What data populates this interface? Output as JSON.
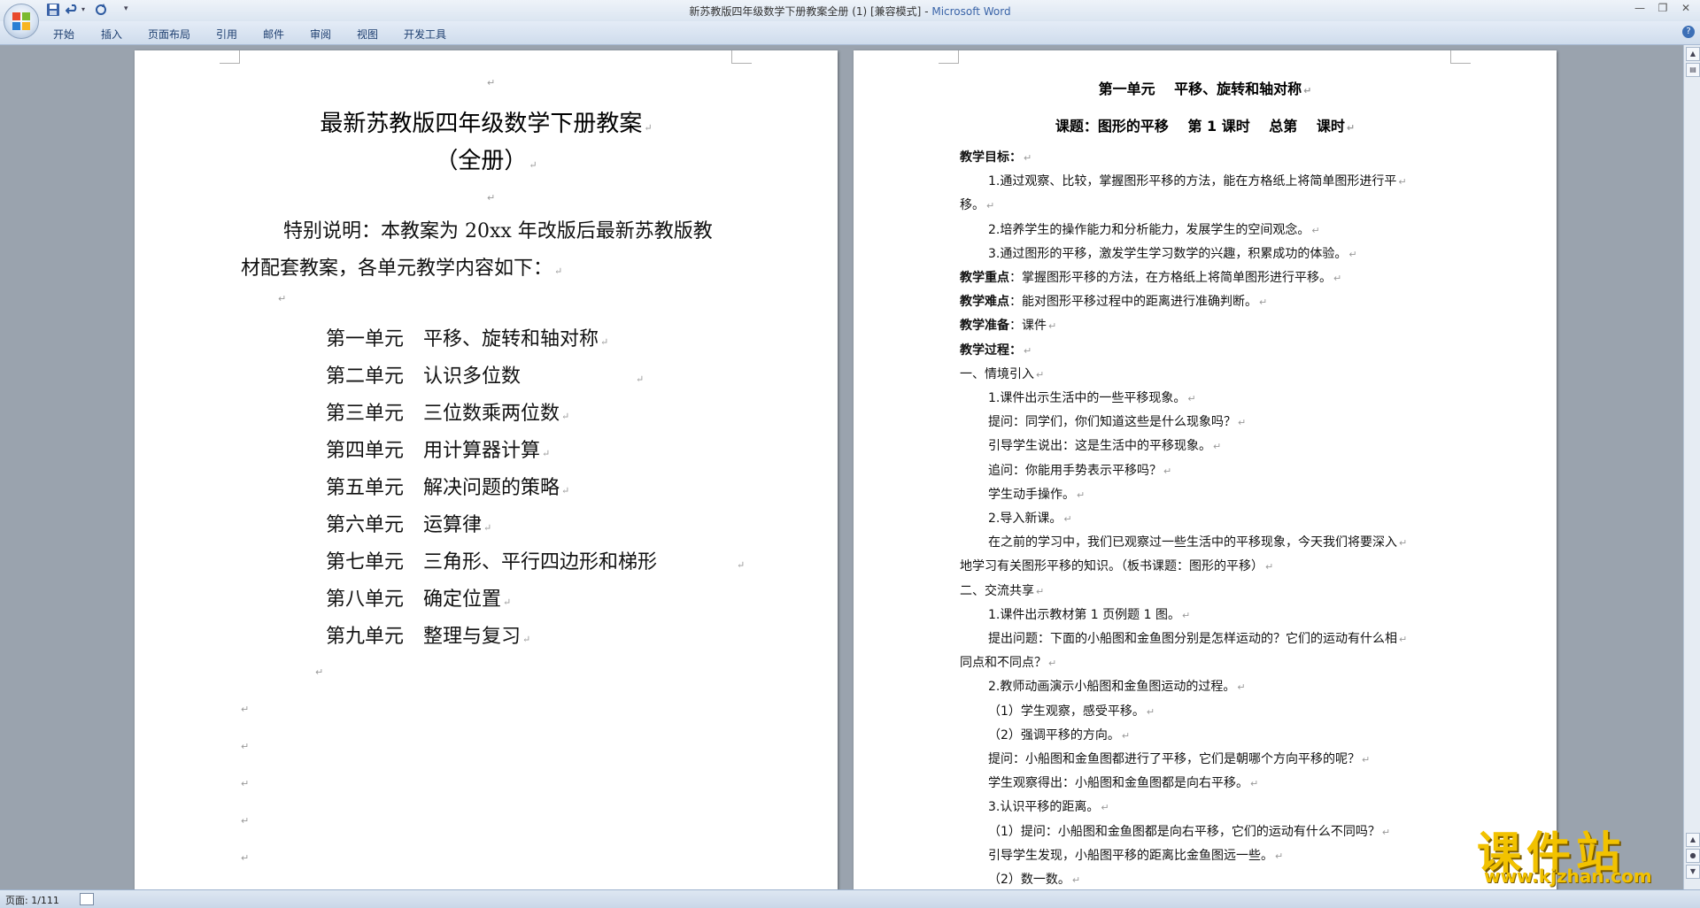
{
  "window": {
    "title": "新苏教版四年级数学下册教案全册 (1) [兼容模式]",
    "app_name": "Microsoft Word",
    "minimize": "—",
    "maximize": "❐",
    "close": "✕"
  },
  "quick_access": [
    "save-icon",
    "undo-icon",
    "redo-icon",
    "customize-icon"
  ],
  "ribbon": {
    "tabs": [
      "开始",
      "插入",
      "页面布局",
      "引用",
      "邮件",
      "审阅",
      "视图",
      "开发工具"
    ],
    "help": "?"
  },
  "left_page": {
    "title": "最新苏教版四年级数学下册教案",
    "subtitle": "（全册）",
    "note_line1": "特别说明：本教案为 20xx 年改版后最新苏教版教",
    "note_line2": "材配套教案，各单元教学内容如下：",
    "units": [
      "第一单元　平移、旋转和轴对称",
      "第二单元　认识多位数",
      "第三单元　三位数乘两位数",
      "第四单元　用计算器计算",
      "第五单元　解决问题的策略",
      "第六单元　运算律",
      "第七单元　三角形、平行四边形和梯形",
      "第八单元　确定位置",
      "第九单元　整理与复习"
    ]
  },
  "right_page": {
    "heading": "第一单元　 平移、旋转和轴对称",
    "lesson": "课题：图形的平移　 第 1 课时　 总第　 课时",
    "lines": [
      {
        "text": "教学目标：",
        "bold": true,
        "indent": 0
      },
      {
        "text": "1.通过观察、比较，掌握图形平移的方法，能在方格纸上将简单图形进行平",
        "bold": false,
        "indent": 1
      },
      {
        "text": "移。",
        "bold": false,
        "indent": 0
      },
      {
        "text": "2.培养学生的操作能力和分析能力，发展学生的空间观念。",
        "bold": false,
        "indent": 1
      },
      {
        "text": "3.通过图形的平移，激发学生学习数学的兴趣，积累成功的体验。",
        "bold": false,
        "indent": 1
      },
      {
        "label": "教学重点",
        "text": "：掌握图形平移的方法，在方格纸上将简单图形进行平移。",
        "bold": false,
        "indent": 0
      },
      {
        "label": "教学难点",
        "text": "：能对图形平移过程中的距离进行准确判断。",
        "bold": false,
        "indent": 0
      },
      {
        "label": "教学准备",
        "text": "：课件",
        "bold": false,
        "indent": 0
      },
      {
        "text": "教学过程：",
        "bold": true,
        "indent": 0
      },
      {
        "text": "一、情境引入",
        "bold": false,
        "indent": 0
      },
      {
        "text": "1.课件出示生活中的一些平移现象。",
        "bold": false,
        "indent": 1
      },
      {
        "text": "提问：同学们，你们知道这些是什么现象吗？",
        "bold": false,
        "indent": 1
      },
      {
        "text": "引导学生说出：这是生活中的平移现象。",
        "bold": false,
        "indent": 1
      },
      {
        "text": "追问：你能用手势表示平移吗？",
        "bold": false,
        "indent": 1
      },
      {
        "text": "学生动手操作。",
        "bold": false,
        "indent": 1
      },
      {
        "text": "2.导入新课。",
        "bold": false,
        "indent": 1
      },
      {
        "text": "在之前的学习中，我们已观察过一些生活中的平移现象，今天我们将要深入",
        "bold": false,
        "indent": 1
      },
      {
        "text": "地学习有关图形平移的知识。（板书课题：图形的平移）",
        "bold": false,
        "indent": 0
      },
      {
        "text": "二、交流共享",
        "bold": false,
        "indent": 0
      },
      {
        "text": "1.课件出示教材第 1 页例题 1 图。",
        "bold": false,
        "indent": 1
      },
      {
        "text": "提出问题：下面的小船图和金鱼图分别是怎样运动的？它们的运动有什么相",
        "bold": false,
        "indent": 1
      },
      {
        "text": "同点和不同点？",
        "bold": false,
        "indent": 0
      },
      {
        "text": "2.教师动画演示小船图和金鱼图运动的过程。",
        "bold": false,
        "indent": 1
      },
      {
        "text": "（1）学生观察，感受平移。",
        "bold": false,
        "indent": 1
      },
      {
        "text": "（2）强调平移的方向。",
        "bold": false,
        "indent": 1
      },
      {
        "text": "提问：小船图和金鱼图都进行了平移，它们是朝哪个方向平移的呢？",
        "bold": false,
        "indent": 1
      },
      {
        "text": "学生观察得出：小船图和金鱼图都是向右平移。",
        "bold": false,
        "indent": 1
      },
      {
        "text": "3.认识平移的距离。",
        "bold": false,
        "indent": 1
      },
      {
        "text": "（1）提问：小船图和金鱼图都是向右平移，它们的运动有什么不同吗？",
        "bold": false,
        "indent": 1
      },
      {
        "text": "引导学生发现，小船图平移的距离比金鱼图远一些。",
        "bold": false,
        "indent": 1
      },
      {
        "text": "（2）数一数。",
        "bold": false,
        "indent": 1
      }
    ]
  },
  "status": {
    "page_info": "页面: 1/111"
  },
  "watermark": {
    "text": "课件站",
    "url": "www.kjzhan.com"
  },
  "colors": {
    "workspace": "#9aa3ae",
    "ribbon": "#cfdcec",
    "accent": "#3a64a8",
    "watermark": "#f2c200"
  }
}
